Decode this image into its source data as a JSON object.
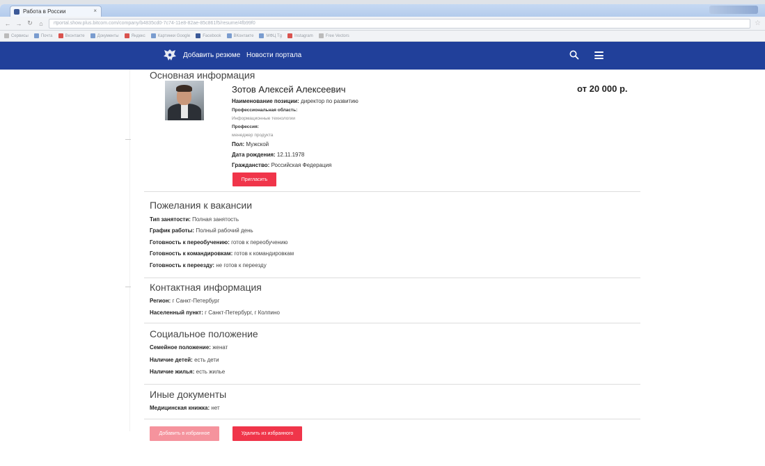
{
  "browser": {
    "tab_title": "Работа в России",
    "url": "rtportal.show.plus.bitcom.com/company/b4835cd0-7c74-11e8-82ae-85c861f5/resume/4fb99f0",
    "bookmarks": [
      "Сервисы",
      "Почта",
      "Вконтакте",
      "Документы",
      "Яндекс",
      "Картинки Google",
      "Facebook",
      "ВКонтакте",
      "МФЦ Tg",
      "Instagram",
      "Free Vectors"
    ]
  },
  "header": {
    "nav": [
      "Добавить резюме",
      "Новости портала"
    ],
    "logo_icon": "coat-of-arms-icon",
    "bg_color": "#21409a"
  },
  "profile": {
    "section_title": "Основная информация",
    "name": "Зотов Алексей Алексеевич",
    "salary": "от 20 000 р.",
    "position_label": "Наименование позиции:",
    "position_value": "директор по развитию",
    "area_label": "Профессиональная область:",
    "area_value": "Информационные технологии",
    "profession_label": "Профессия:",
    "profession_value": "менеджер продукта",
    "gender_label": "Пол:",
    "gender_value": "Мужской",
    "birth_label": "Дата рождения:",
    "birth_value": "12.11.1978",
    "citizenship_label": "Гражданство:",
    "citizenship_value": "Российская Федерация",
    "invite_button": "Пригласить"
  },
  "wishes": {
    "section_title": "Пожелания к вакансии",
    "rows": [
      {
        "label": "Тип занятости:",
        "value": "Полная занятость"
      },
      {
        "label": "График работы:",
        "value": "Полный рабочий день"
      },
      {
        "label": "Готовность к переобучению:",
        "value": "готов к переобучению"
      },
      {
        "label": "Готовность к командировкам:",
        "value": "готов к командировкам"
      },
      {
        "label": "Готовность к переезду:",
        "value": "не готов к переезду"
      }
    ]
  },
  "contacts": {
    "section_title": "Контактная информация",
    "rows": [
      {
        "label": "Регион:",
        "value": "г Санкт-Петербург"
      },
      {
        "label": "Населенный пункт:",
        "value": "г Санкт-Петербург, г Колпино"
      }
    ]
  },
  "social": {
    "section_title": "Социальное положение",
    "rows": [
      {
        "label": "Семейное положение:",
        "value": "женат"
      },
      {
        "label": "Наличие детей:",
        "value": "есть дети"
      },
      {
        "label": "Наличие жилья:",
        "value": "есть жилье"
      }
    ]
  },
  "documents": {
    "section_title": "Иные документы",
    "rows": [
      {
        "label": "Медицинская книжка:",
        "value": "нет"
      }
    ]
  },
  "actions": {
    "add_favorite": "Добавить в избранное",
    "remove_favorite": "Удалить из избранного"
  },
  "colors": {
    "accent": "#f0354a",
    "accent_disabled": "#f5939d"
  }
}
